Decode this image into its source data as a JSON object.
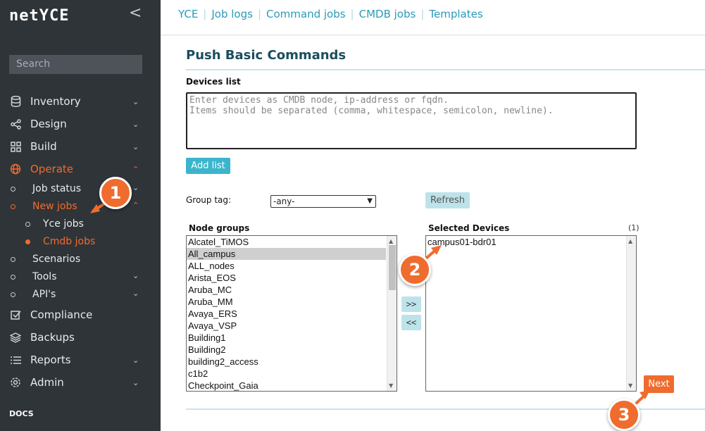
{
  "sidebar": {
    "logo": "netYCE",
    "collapse": "<",
    "search_placeholder": "Search",
    "items": [
      {
        "label": "Inventory",
        "icon": "database-icon",
        "chev": "⌄"
      },
      {
        "label": "Design",
        "icon": "share-icon",
        "chev": "⌄"
      },
      {
        "label": "Build",
        "icon": "grid-icon",
        "chev": "⌄"
      },
      {
        "label": "Operate",
        "icon": "globe-icon",
        "chev": "⌃"
      },
      {
        "label": "Compliance",
        "icon": "check-square-icon"
      },
      {
        "label": "Backups",
        "icon": "layers-icon"
      },
      {
        "label": "Reports",
        "icon": "list-icon",
        "chev": "⌄"
      },
      {
        "label": "Admin",
        "icon": "gear-icon",
        "chev": "⌄"
      }
    ],
    "operate_sub": [
      {
        "label": "Job status",
        "chev": "⌄"
      },
      {
        "label": "New jobs",
        "chev": "⌃"
      },
      {
        "label": "Yce jobs"
      },
      {
        "label": "Cmdb jobs"
      },
      {
        "label": "Scenarios"
      },
      {
        "label": "Tools",
        "chev": "⌄"
      },
      {
        "label": "API's",
        "chev": "⌄"
      }
    ],
    "docs": "DOCS"
  },
  "topnav": [
    "YCE",
    "Job logs",
    "Command jobs",
    "CMDB jobs",
    "Templates"
  ],
  "main": {
    "title": "Push Basic Commands",
    "devices_list_label": "Devices list",
    "devices_placeholder": "Enter devices as CMDB node, ip-address or fqdn.\nItems should be separated (comma, whitespace, semicolon, newline).",
    "add_list": "Add list",
    "group_tag_label": "Group tag:",
    "group_tag_value": "-any-",
    "refresh": "Refresh",
    "node_groups_label": "Node groups",
    "node_groups": [
      "Alcatel_TiMOS",
      "All_campus",
      "ALL_nodes",
      "Arista_EOS",
      "Aruba_MC",
      "Aruba_MM",
      "Avaya_ERS",
      "Avaya_VSP",
      "Building1",
      "Building2",
      "building2_access",
      "c1b2",
      "Checkpoint_Gaia"
    ],
    "node_groups_selected": "All_campus",
    "selected_devices_label": "Selected Devices",
    "selected_count": "(1)",
    "selected_devices": [
      "campus01-bdr01"
    ],
    "move_right": ">>",
    "move_left": "<<",
    "next": "Next"
  },
  "callouts": [
    "1",
    "2",
    "3"
  ],
  "colors": {
    "accent": "#ef6c2e",
    "link": "#2a9bb8",
    "sidebar": "#2f3438"
  }
}
